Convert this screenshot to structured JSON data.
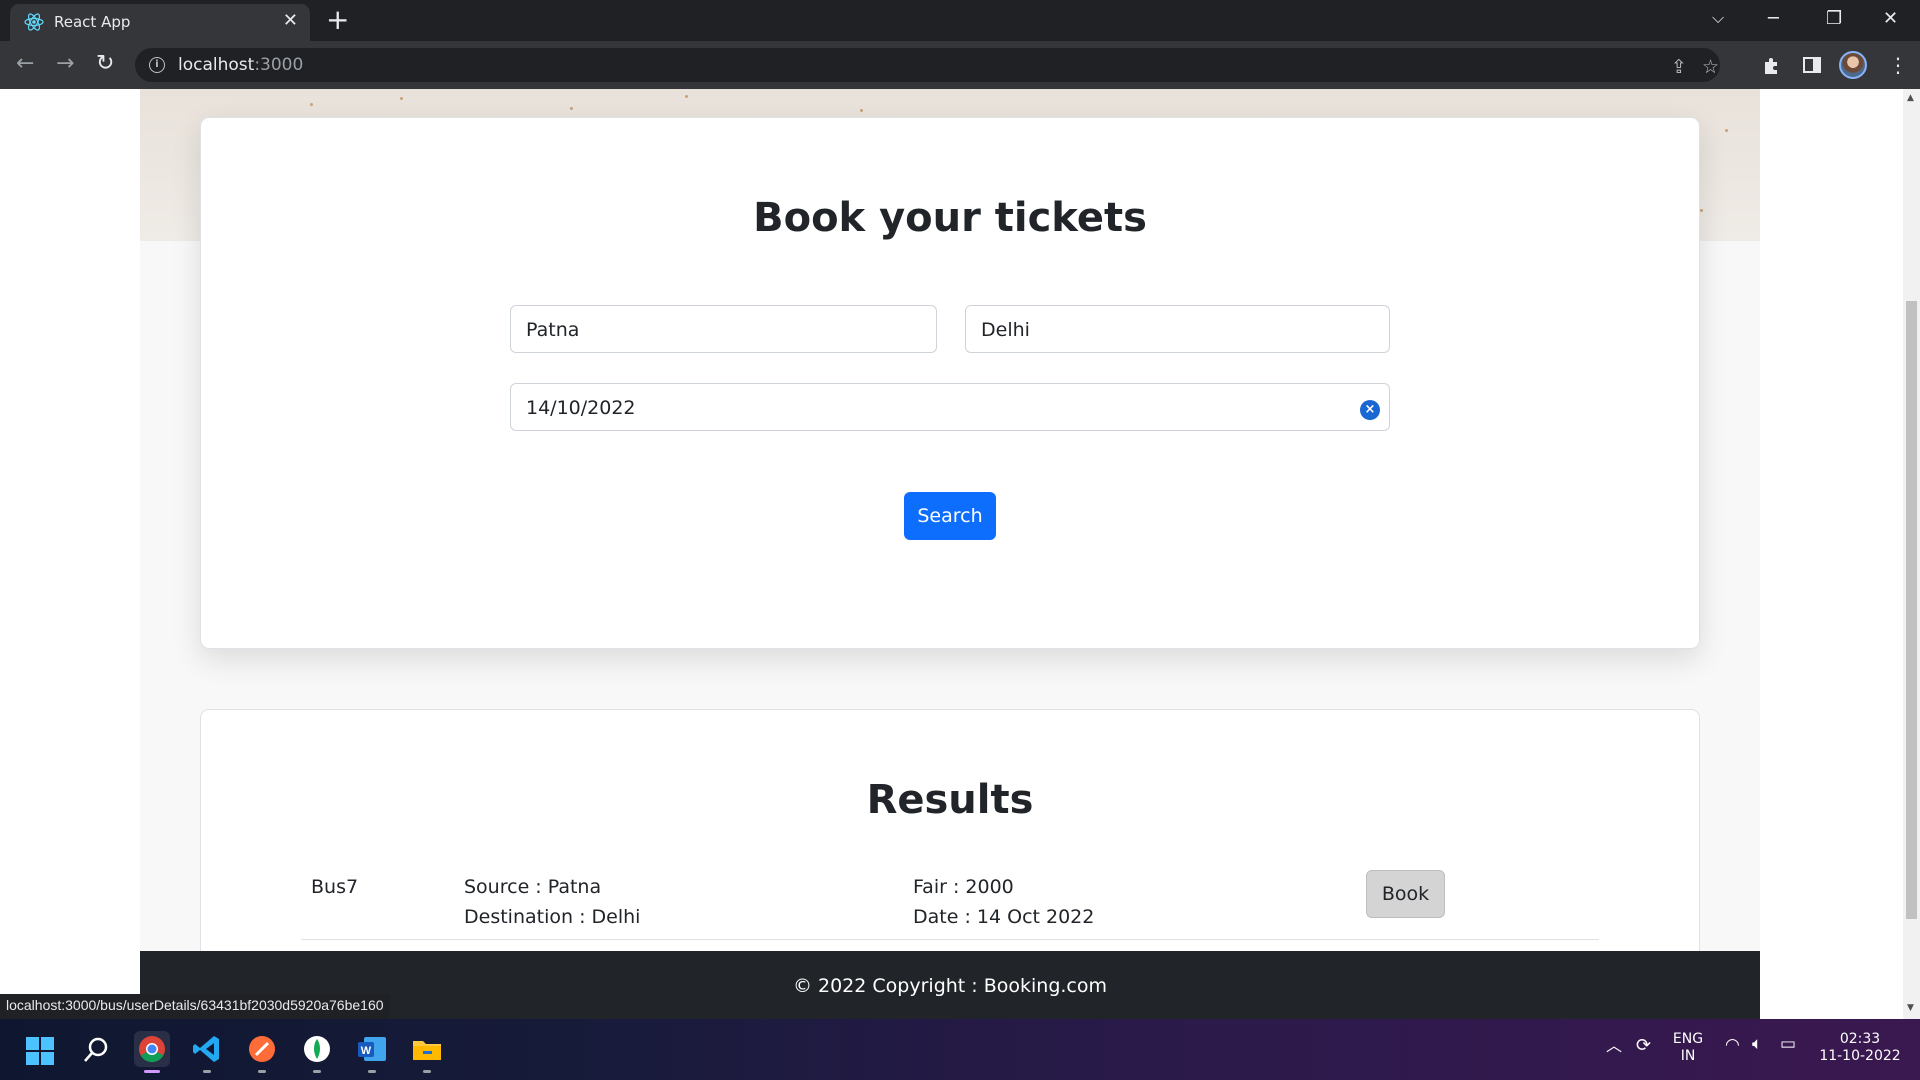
{
  "browser": {
    "tab_title": "React App",
    "url_host": "localhost",
    "url_port": ":3000",
    "status_url": "localhost:3000/bus/userDetails/63431bf2030d5920a76be160"
  },
  "booking": {
    "title": "Book your tickets",
    "source_value": "Patna",
    "destination_value": "Delhi",
    "date_value": "14/10/2022",
    "search_label": "Search"
  },
  "results": {
    "title": "Results",
    "items": [
      {
        "name": "Bus7",
        "source": "Source : Patna",
        "destination": "Destination : Delhi",
        "fare": "Fair : 2000",
        "date": "Date : 14 Oct 2022",
        "book_label": "Book"
      }
    ]
  },
  "footer": {
    "text": "© 2022 Copyright : Booking.com"
  },
  "taskbar": {
    "lang_line1": "ENG",
    "lang_line2": "IN",
    "time": "02:33",
    "date": "11-10-2022"
  },
  "colors": {
    "primary": "#0d6efd",
    "footer_bg": "#212529",
    "chrome_dark": "#202124"
  }
}
